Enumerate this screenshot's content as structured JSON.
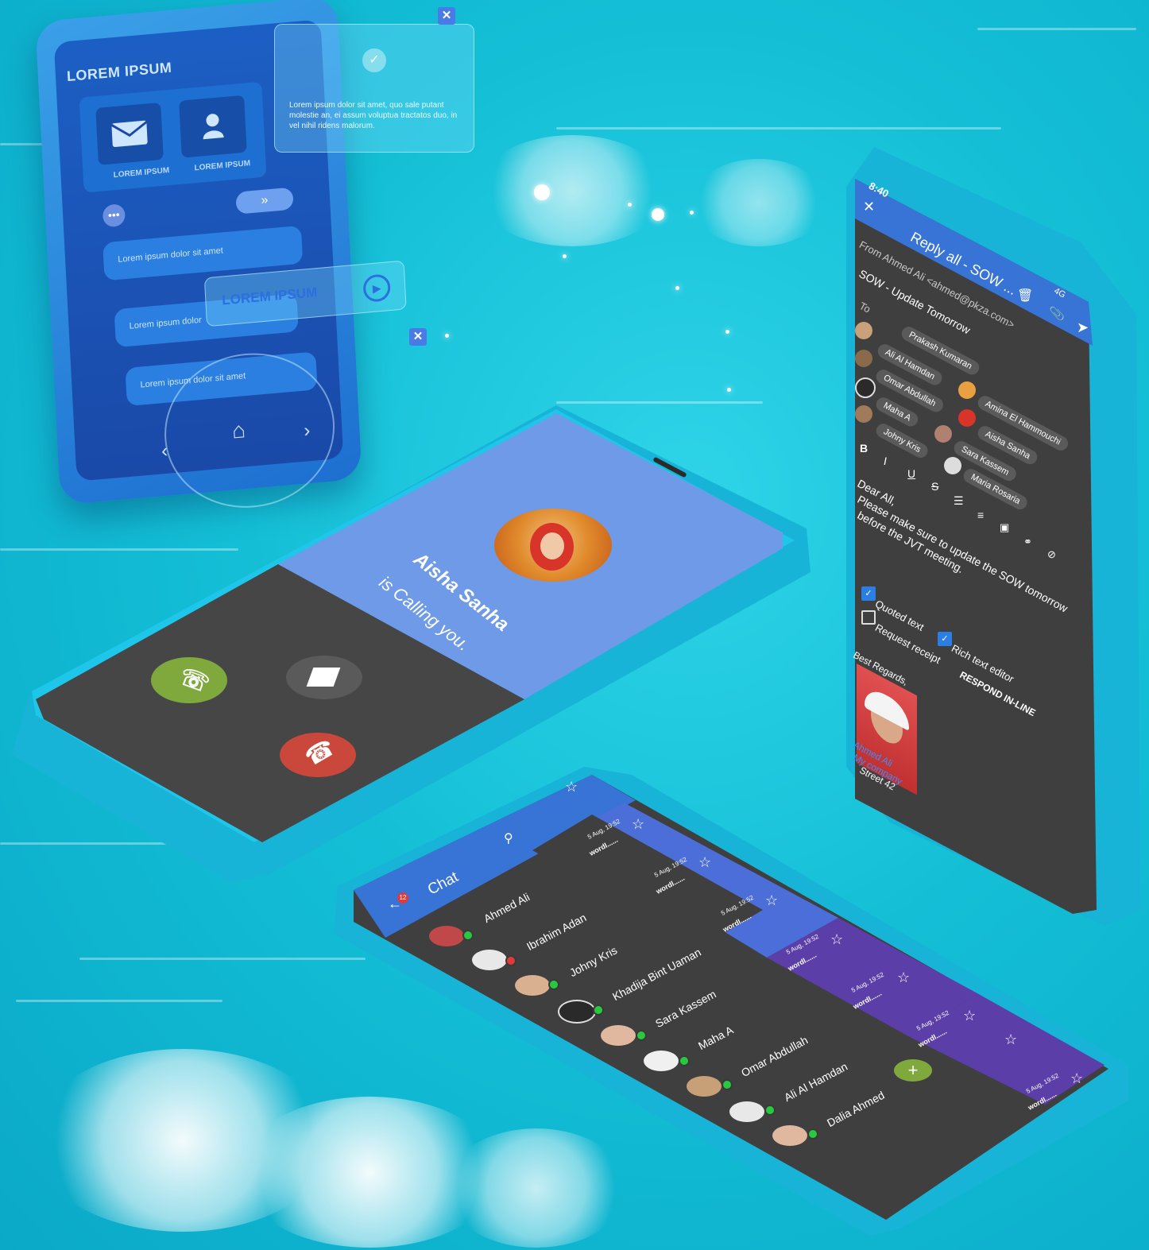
{
  "hologram": {
    "title": "LOREM IPSUM",
    "tile_labels": [
      "LOREM IPSUM",
      "LOREM IPSUM"
    ],
    "bar1": "Lorem ipsum dolor sit amet",
    "bar2": "Lorem ipsum dolor",
    "bar3": "Lorem ipsum dolor sit amet",
    "button": "LOREM IPSUM",
    "glass_text": "Lorem ipsum dolor sit amet, quo sale putant molestie an, ei assum voluptua tractatos duo, in vel nihil ridens malorum."
  },
  "call": {
    "caller": "Aisha Sanha",
    "subtitle": "is Calling you.",
    "colors": {
      "top": "#6e9ae8",
      "bottom": "#464646",
      "accept": "#7fa83d",
      "decline": "#c9483b",
      "message": "#5a5a5a"
    }
  },
  "email": {
    "time": "8:40",
    "network": "4G",
    "title": "Reply all - SOW ...",
    "from": "From Ahmed Ali <ahmed@pkza.com>",
    "subject": "SOW - Update Tomorrow",
    "to_label": "To",
    "recipients_left": [
      "Prakash Kumaran",
      "Ali Al Hamdan",
      "Omar Abdullah",
      "Maha A",
      "Johny Kris"
    ],
    "recipients_right": [
      "Amina El Hammouchi",
      "Aisha Sanha",
      "Sara Kassem",
      "Maria Rosaria"
    ],
    "format_tools": [
      "B",
      "I",
      "U",
      "S"
    ],
    "body_greeting": "Dear All,",
    "body_line1": "Please make sure to update the SOW tomorrow",
    "body_line2": "before the JVT meeting.",
    "quoted_text": "Quoted text",
    "request_receipt": "Request receipt",
    "rich_text_editor": "Rich text editor",
    "respond_inline": "RESPOND IN-LINE",
    "signature_regards": "Best Regards,",
    "signature_name": "Ahmed Ali",
    "signature_company": "My company",
    "signature_street": "Street 42"
  },
  "chat": {
    "title": "Chat",
    "badge": "12",
    "contacts": [
      "Ahmed Ali",
      "Ibrahim Adan",
      "Johny Kris",
      "Khadija Bint Uaman",
      "Sara Kassem",
      "Maha A",
      "Omar Abdullah",
      "Ali Al Hamdan",
      "Dalia Ahmed"
    ],
    "message_date": "5 Aug, 19:52",
    "message_snippet": "wordl......",
    "fab": "+"
  }
}
